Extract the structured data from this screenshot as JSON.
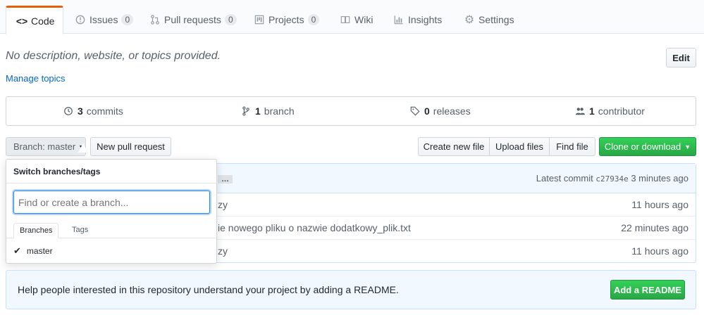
{
  "tabs": [
    {
      "label": "Code",
      "icon": "code-icon"
    },
    {
      "label": "Issues",
      "count": "0",
      "icon": "issue-icon"
    },
    {
      "label": "Pull requests",
      "count": "0",
      "icon": "pull-request-icon"
    },
    {
      "label": "Projects",
      "count": "0",
      "icon": "project-icon"
    },
    {
      "label": "Wiki",
      "icon": "book-icon"
    },
    {
      "label": "Insights",
      "icon": "graph-icon"
    },
    {
      "label": "Settings",
      "icon": "gear-icon"
    }
  ],
  "description": "No description, website, or topics provided.",
  "edit_label": "Edit",
  "manage_topics": "Manage topics",
  "summary": {
    "commits_count": "3",
    "commits_label": "commits",
    "branch_count": "1",
    "branch_label": "branch",
    "releases_count": "0",
    "releases_label": "releases",
    "contributor_count": "1",
    "contributor_label": "contributor"
  },
  "toolbar": {
    "branch_label": "Branch: master",
    "new_pr": "New pull request",
    "create_file": "Create new file",
    "upload_files": "Upload files",
    "find_file": "Find file",
    "clone": "Clone or download"
  },
  "commit_bar": {
    "ellipsis": "…",
    "latest_prefix": "Latest commit",
    "sha": "c27934e",
    "age": "3 minutes ago"
  },
  "files": [
    {
      "message": "zy",
      "age": "11 hours ago"
    },
    {
      "message": "ie nowego pliku o nazwie dodatkowy_plik.txt",
      "age": "22 minutes ago"
    },
    {
      "message": "zy",
      "age": "11 hours ago"
    }
  ],
  "dropdown": {
    "title": "Switch branches/tags",
    "placeholder": "Find or create a branch...",
    "tab_branches": "Branches",
    "tab_tags": "Tags",
    "item": "master"
  },
  "readme": {
    "text": "Help people interested in this repository understand your project by adding a README.",
    "button": "Add a README"
  },
  "colors": {
    "accent": "#0366d6",
    "tab_active": "#e36209",
    "green": "#28a745"
  }
}
